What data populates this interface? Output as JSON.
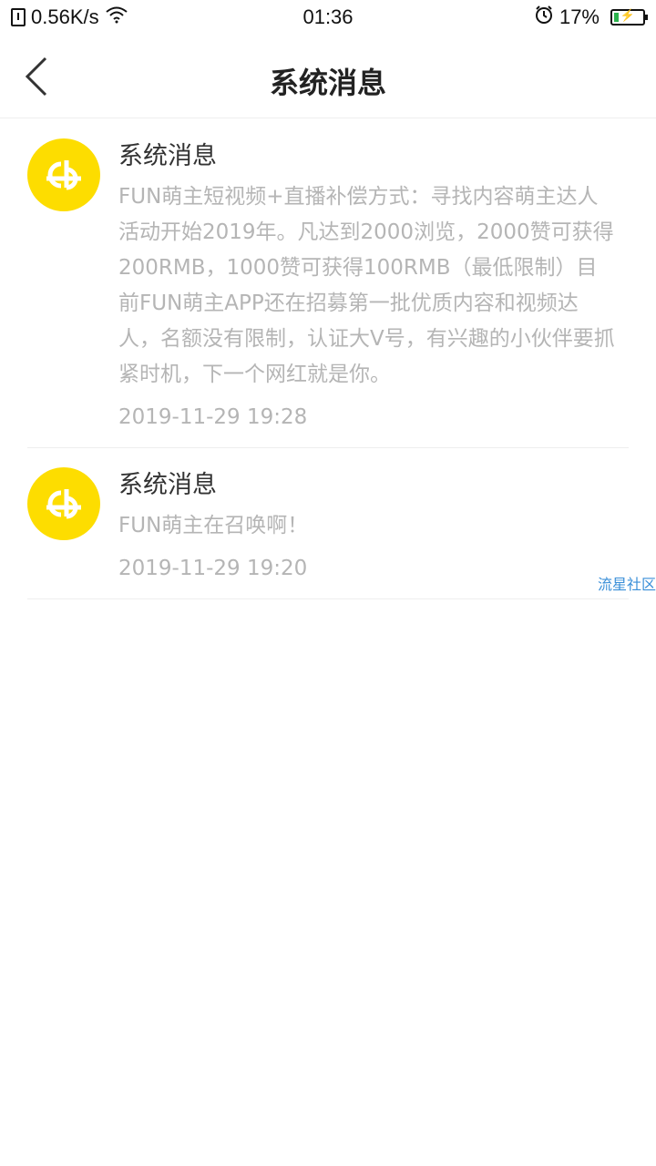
{
  "status_bar": {
    "network_speed": "0.56K/s",
    "time": "01:36",
    "battery_percent": "17%",
    "battery_level": 0.17
  },
  "header": {
    "title": "系统消息",
    "back_icon": "chevron-left-icon"
  },
  "messages": [
    {
      "title": "系统消息",
      "body": "FUN萌主短视频+直播补偿方式：寻找内容萌主达人活动开始2019年。凡达到2000浏览，2000赞可获得200RMB，1000赞可获得100RMB（最低限制）目前FUN萌主APP还在招募第一批优质内容和视频达人，名额没有限制，认证大V号，有兴趣的小伙伴要抓紧时机，下一个网红就是你。",
      "time": "2019-11-29 19:28"
    },
    {
      "title": "系统消息",
      "body": "FUN萌主在召唤啊！",
      "time": "2019-11-29 19:20"
    }
  ],
  "watermark": "流星社区",
  "colors": {
    "avatar_bg": "#fddd00",
    "secondary_text": "#b5b5b5",
    "watermark": "#3a8fd8"
  }
}
